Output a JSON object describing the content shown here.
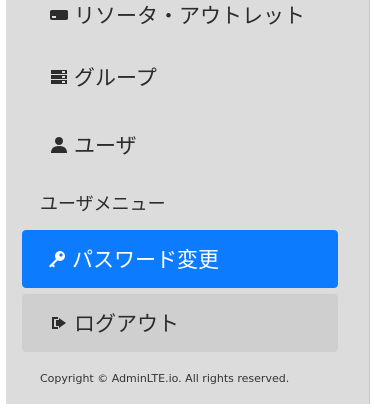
{
  "sidebar": {
    "items": [
      {
        "label": "リソータ・アウトレット",
        "icon": "hdd-icon"
      },
      {
        "label": "グループ",
        "icon": "server-icon"
      },
      {
        "label": "ユーザ",
        "icon": "user-icon"
      }
    ],
    "section_header": "ユーザメニュー",
    "user_menu": [
      {
        "label": "パスワード変更",
        "icon": "key-icon",
        "active": true
      },
      {
        "label": "ログアウト",
        "icon": "sign-out-icon"
      }
    ],
    "footer": "Copyright © AdminLTE.io. All rights reserved."
  },
  "colors": {
    "active_bg": "#0d7bfd",
    "sidebar_bg": "#dcdcdc",
    "logout_bg": "#cfcfcf",
    "text": "#2c2c2c"
  }
}
